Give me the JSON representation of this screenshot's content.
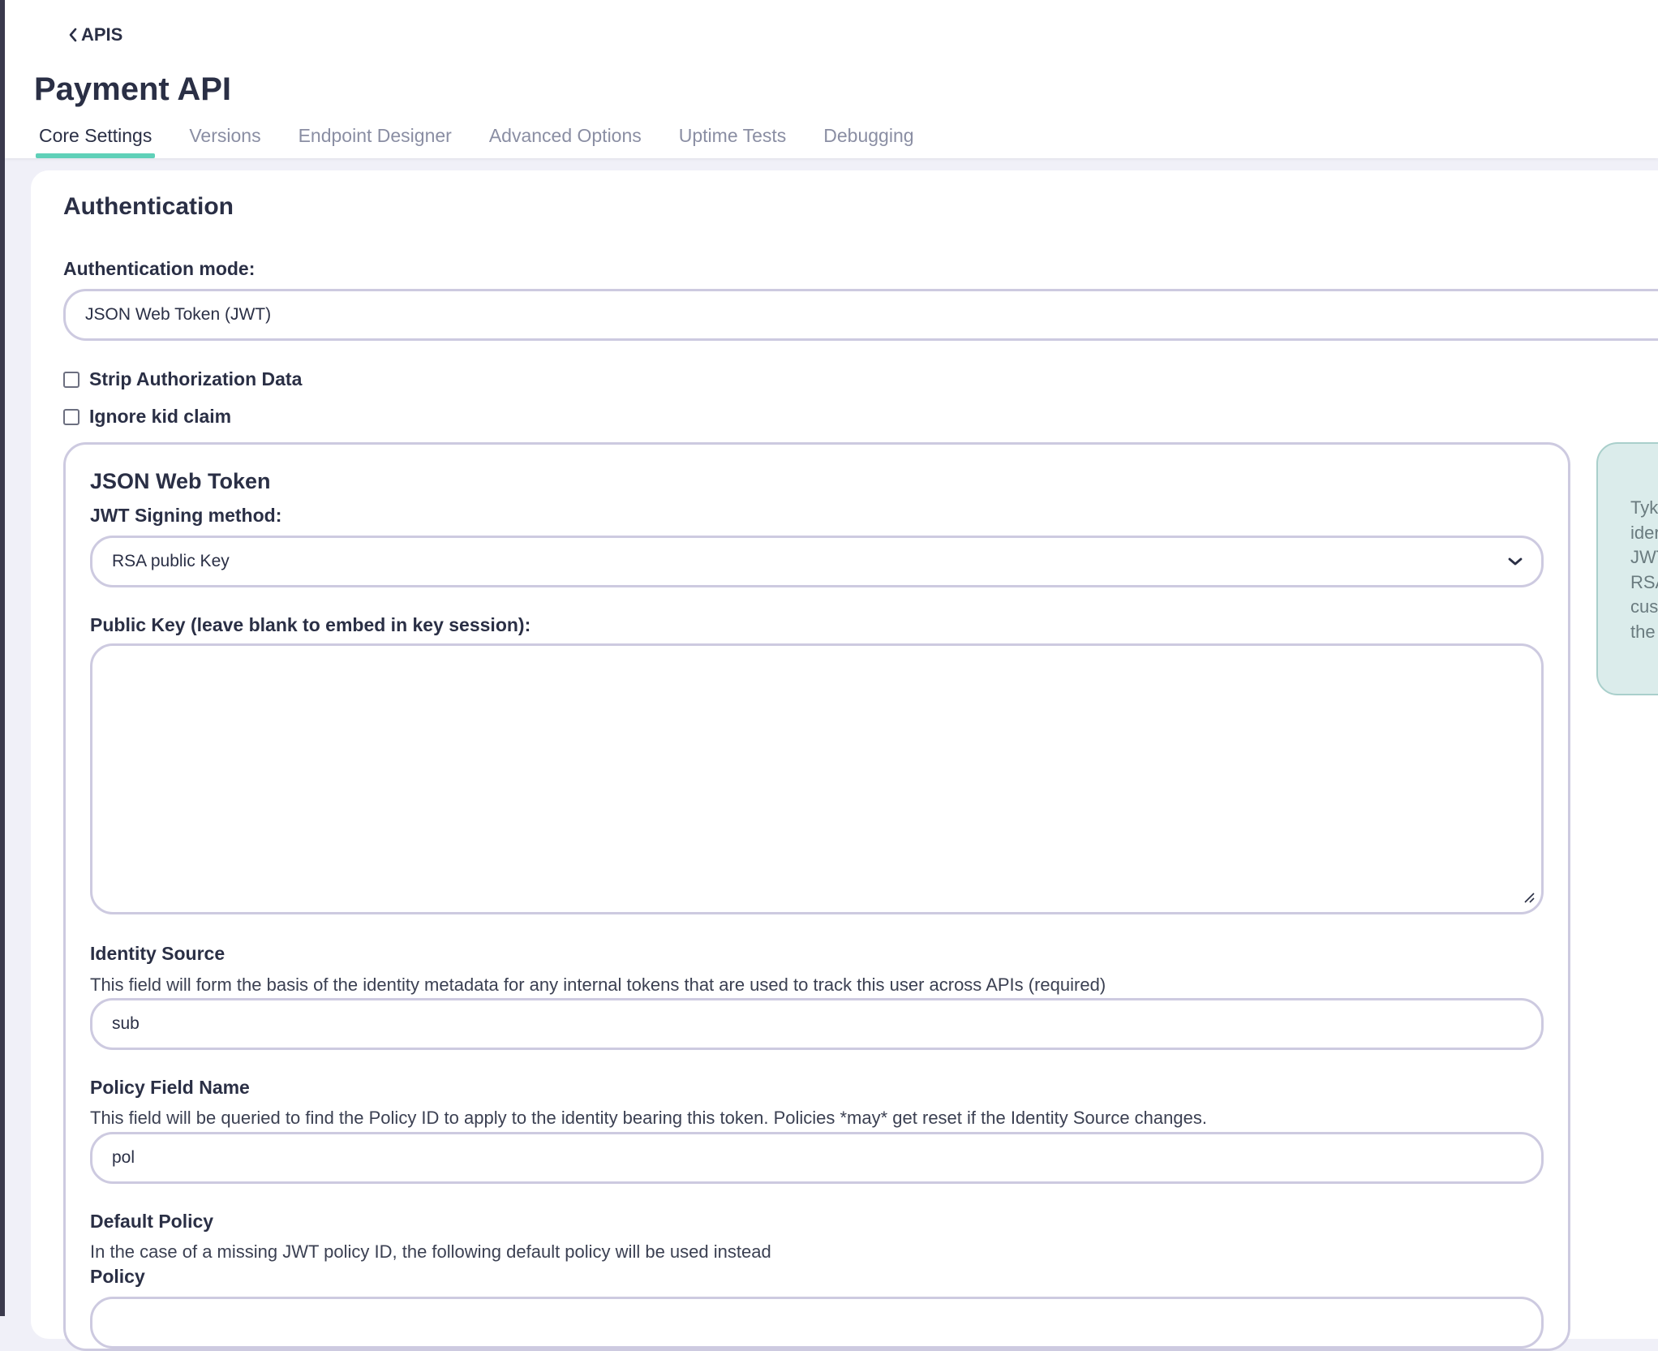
{
  "nav": {
    "back_label": "APIS"
  },
  "page": {
    "title": "Payment API"
  },
  "tabs": [
    {
      "label": "Core Settings",
      "active": true
    },
    {
      "label": "Versions"
    },
    {
      "label": "Endpoint Designer"
    },
    {
      "label": "Advanced Options"
    },
    {
      "label": "Uptime Tests"
    },
    {
      "label": "Debugging"
    }
  ],
  "auth": {
    "section_title": "Authentication",
    "mode_label": "Authentication mode:",
    "mode_value": "JSON Web Token (JWT)",
    "strip_auth_label": "Strip Authorization Data",
    "ignore_kid_label": "Ignore kid claim"
  },
  "jwt": {
    "title": "JSON Web Token",
    "signing_label": "JWT Signing method:",
    "signing_value": "RSA public Key",
    "public_key_label": "Public Key (leave blank to embed in key session):",
    "public_key_value": "",
    "identity_source_label": "Identity Source",
    "identity_source_help": "This field will form the basis of the identity metadata for any internal tokens that are used to track this user across APIs (required)",
    "identity_source_value": "sub",
    "policy_field_label": "Policy Field Name",
    "policy_field_help": "This field will be queried to find the Policy ID to apply to the identity bearing this token. Policies *may* get reset if the Identity Source changes.",
    "policy_field_value": "pol",
    "default_policy_label": "Default Policy",
    "default_policy_help": "In the case of a missing JWT policy ID, the following default policy will be used instead",
    "policy_label": "Policy"
  },
  "info_panel": {
    "lines": [
      "Tyk",
      "ider",
      "JWT",
      "RSA",
      "cus",
      "the"
    ]
  },
  "colors": {
    "tab_active_underline": "#5fd0b8",
    "input_border": "#cdcae0",
    "info_panel_bg": "#dbeceb"
  }
}
